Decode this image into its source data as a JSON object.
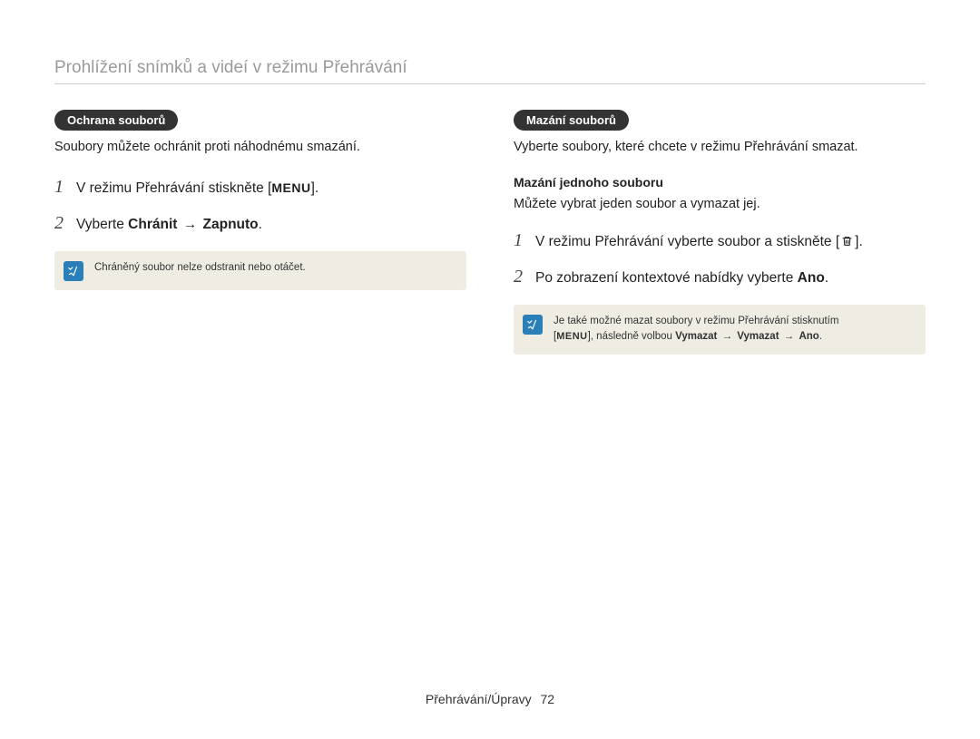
{
  "page_title": "Prohlížení snímků a videí v režimu Přehrávání",
  "left": {
    "pill": "Ochrana souborů",
    "intro": "Soubory můžete ochránit proti náhodnému smazání.",
    "steps": [
      {
        "num": "1",
        "pre": "V režimu Přehrávání stiskněte [",
        "glyph": "MENU",
        "post": "]."
      },
      {
        "num": "2",
        "pre": "Vyberte ",
        "bold1": "Chránit",
        "arrow": "→",
        "bold2": "Zapnuto",
        "post2": "."
      }
    ],
    "note": "Chráněný soubor nelze odstranit nebo otáčet."
  },
  "right": {
    "pill": "Mazání souborů",
    "intro": "Vyberte soubory, které chcete v režimu Přehrávání smazat.",
    "sub_heading": "Mazání jednoho souboru",
    "sub_intro": "Můžete vybrat jeden soubor a vymazat jej.",
    "steps": [
      {
        "num": "1",
        "pre": "V režimu Přehrávání vyberte soubor a stiskněte [",
        "icon": "trash",
        "post": "]."
      },
      {
        "num": "2",
        "pre": "Po zobrazení kontextové nabídky vyberte ",
        "bold1": "Ano",
        "post2": "."
      }
    ],
    "note_line1": "Je také možné mazat soubory v režimu Přehrávání stisknutím",
    "note_line2_pre": "[",
    "note_line2_glyph": "MENU",
    "note_line2_mid": "], následně volbou ",
    "note_line2_b1": "Vymazat",
    "note_line2_arrow1": "→",
    "note_line2_b2": "Vymazat",
    "note_line2_arrow2": "→",
    "note_line2_b3": "Ano",
    "note_line2_end": "."
  },
  "footer": {
    "section": "Přehrávání/Úpravy",
    "page": "72"
  }
}
